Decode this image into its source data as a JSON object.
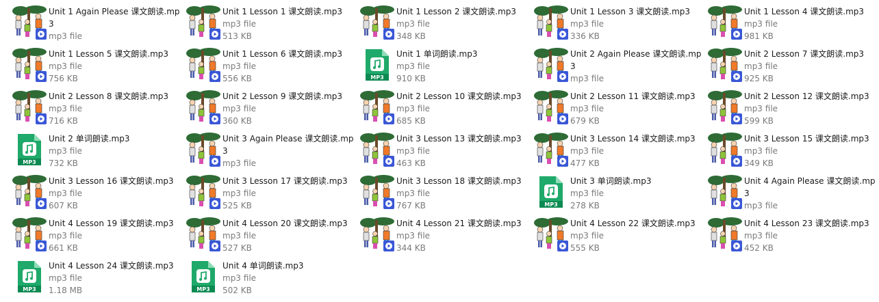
{
  "items": [
    {
      "name": "Unit 1 Again Please 课文朗读.mp3",
      "type": "mp3 file",
      "size": "",
      "thumb": "art"
    },
    {
      "name": "Unit 1 Lesson 1 课文朗读.mp3",
      "type": "mp3 file",
      "size": "513 KB",
      "thumb": "art"
    },
    {
      "name": "Unit 1 Lesson 2 课文朗读.mp3",
      "type": "mp3 file",
      "size": "348 KB",
      "thumb": "art"
    },
    {
      "name": "Unit 1 Lesson 3 课文朗读.mp3",
      "type": "mp3 file",
      "size": "336 KB",
      "thumb": "art"
    },
    {
      "name": "Unit 1 Lesson 4 课文朗读.mp3",
      "type": "mp3 file",
      "size": "981 KB",
      "thumb": "art"
    },
    {
      "name": "Unit 1 Lesson 5 课文朗读.mp3",
      "type": "mp3 file",
      "size": "756 KB",
      "thumb": "art"
    },
    {
      "name": "Unit 1 Lesson 6 课文朗读.mp3",
      "type": "mp3 file",
      "size": "556 KB",
      "thumb": "art"
    },
    {
      "name": "Unit 1 单词朗读.mp3",
      "type": "mp3 file",
      "size": "910 KB",
      "thumb": "mp3"
    },
    {
      "name": "Unit 2 Again Please 课文朗读.mp3",
      "type": "mp3 file",
      "size": "",
      "thumb": "art"
    },
    {
      "name": "Unit 2 Lesson 7 课文朗读.mp3",
      "type": "mp3 file",
      "size": "925 KB",
      "thumb": "art"
    },
    {
      "name": "Unit 2 Lesson 8 课文朗读.mp3",
      "type": "mp3 file",
      "size": "716 KB",
      "thumb": "art"
    },
    {
      "name": "Unit 2 Lesson 9 课文朗读.mp3",
      "type": "mp3 file",
      "size": "360 KB",
      "thumb": "art"
    },
    {
      "name": "Unit 2 Lesson 10 课文朗读.mp3",
      "type": "mp3 file",
      "size": "685 KB",
      "thumb": "art"
    },
    {
      "name": "Unit 2 Lesson 11 课文朗读.mp3",
      "type": "mp3 file",
      "size": "679 KB",
      "thumb": "art"
    },
    {
      "name": "Unit 2 Lesson 12 课文朗读.mp3",
      "type": "mp3 file",
      "size": "599 KB",
      "thumb": "art"
    },
    {
      "name": "Unit 2 单词朗读.mp3",
      "type": "mp3 file",
      "size": "732 KB",
      "thumb": "mp3"
    },
    {
      "name": "Unit 3 Again Please 课文朗读.mp3",
      "type": "mp3 file",
      "size": "",
      "thumb": "art"
    },
    {
      "name": "Unit 3 Lesson 13 课文朗读.mp3",
      "type": "mp3 file",
      "size": "463 KB",
      "thumb": "art"
    },
    {
      "name": "Unit 3 Lesson 14 课文朗读.mp3",
      "type": "mp3 file",
      "size": "477 KB",
      "thumb": "art"
    },
    {
      "name": "Unit 3 Lesson 15 课文朗读.mp3",
      "type": "mp3 file",
      "size": "349 KB",
      "thumb": "art"
    },
    {
      "name": "Unit 3 Lesson 16 课文朗读.mp3",
      "type": "mp3 file",
      "size": "607 KB",
      "thumb": "art"
    },
    {
      "name": "Unit 3 Lesson 17 课文朗读.mp3",
      "type": "mp3 file",
      "size": "525 KB",
      "thumb": "art"
    },
    {
      "name": "Unit 3 Lesson 18 课文朗读.mp3",
      "type": "mp3 file",
      "size": "767 KB",
      "thumb": "art"
    },
    {
      "name": "Unit 3 单词朗读.mp3",
      "type": "mp3 file",
      "size": "278 KB",
      "thumb": "mp3"
    },
    {
      "name": "Unit 4 Again Please 课文朗读.mp3",
      "type": "mp3 file",
      "size": "",
      "thumb": "art"
    },
    {
      "name": "Unit 4 Lesson 19 课文朗读.mp3",
      "type": "mp3 file",
      "size": "661 KB",
      "thumb": "art"
    },
    {
      "name": "Unit 4 Lesson 20 课文朗读.mp3",
      "type": "mp3 file",
      "size": "527 KB",
      "thumb": "art"
    },
    {
      "name": "Unit 4 Lesson 21 课文朗读.mp3",
      "type": "mp3 file",
      "size": "344 KB",
      "thumb": "art"
    },
    {
      "name": "Unit 4 Lesson 22 课文朗读.mp3",
      "type": "mp3 file",
      "size": "555 KB",
      "thumb": "art"
    },
    {
      "name": "Unit 4 Lesson 23 课文朗读.mp3",
      "type": "mp3 file",
      "size": "452 KB",
      "thumb": "art"
    },
    {
      "name": "Unit 4 Lesson 24 课文朗读.mp3",
      "type": "mp3 file",
      "size": "1.18 MB",
      "thumb": "mp3"
    },
    {
      "name": "Unit 4 单词朗读.mp3",
      "type": "mp3 file",
      "size": "502 KB",
      "thumb": "mp3"
    }
  ],
  "mp3_badge": "MP3",
  "colors": {
    "mp3_green": "#1fa96a",
    "play_badge": "#3a57d6",
    "tree": "#2e6b35"
  }
}
